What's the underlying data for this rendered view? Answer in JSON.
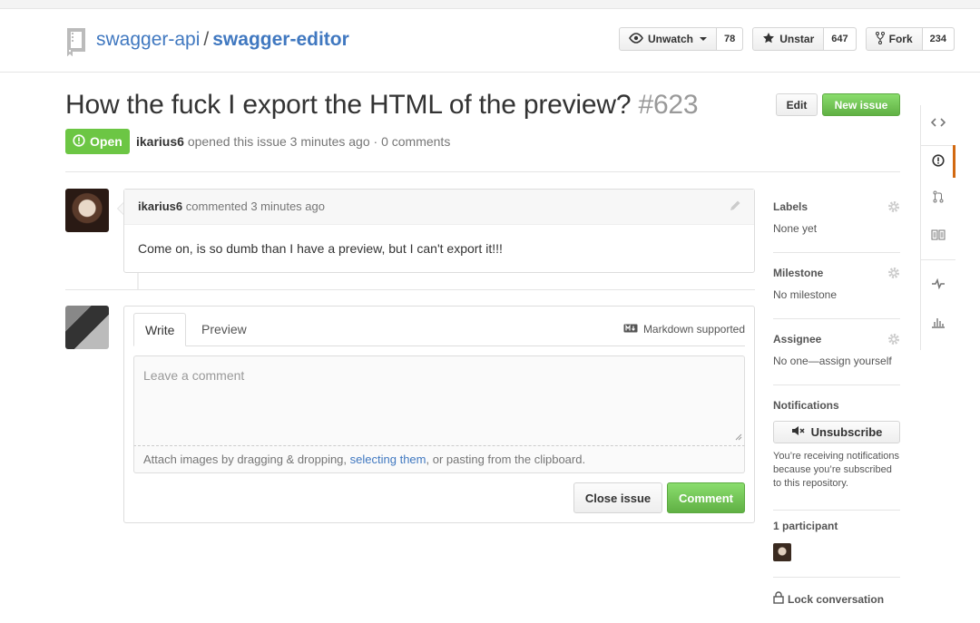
{
  "repo": {
    "owner": "swagger-api",
    "separator": "/",
    "name": "swagger-editor"
  },
  "actions": {
    "watch": {
      "label": "Unwatch",
      "count": "78"
    },
    "star": {
      "label": "Unstar",
      "count": "647"
    },
    "fork": {
      "label": "Fork",
      "count": "234"
    }
  },
  "issue": {
    "title": "How the fuck I export the HTML of the preview?",
    "number": "#623",
    "state": "Open",
    "author": "ikarius6",
    "meta_text": "opened this issue 3 minutes ago · 0 comments",
    "edit_label": "Edit",
    "new_issue_label": "New issue"
  },
  "comment": {
    "author": "ikarius6",
    "time": "commented 3 minutes ago",
    "body": "Come on, is so dumb than I have a preview, but I can't export it!!!"
  },
  "composer": {
    "tab_write": "Write",
    "tab_preview": "Preview",
    "markdown_note": "Markdown supported",
    "placeholder": "Leave a comment",
    "attach_prefix": "Attach images by dragging & dropping,",
    "attach_link": "selecting them",
    "attach_suffix": ", or pasting from the clipboard.",
    "close_label": "Close issue",
    "comment_label": "Comment"
  },
  "sidebar": {
    "labels_title": "Labels",
    "labels_value": "None yet",
    "milestone_title": "Milestone",
    "milestone_value": "No milestone",
    "assignee_title": "Assignee",
    "assignee_value": "No one—assign yourself",
    "notifications_title": "Notifications",
    "unsubscribe_label": "Unsubscribe",
    "notifications_note": "You’re receiving notifications because you’re subscribed to this repository.",
    "participants_title": "1 participant",
    "lock_label": "Lock conversation"
  },
  "colors": {
    "accent": "#4078c0",
    "open_green": "#6cc644",
    "active_tab": "#d26911"
  },
  "icons": [
    "repo-icon",
    "eye-icon",
    "star-icon",
    "fork-icon",
    "code-icon",
    "issue-icon",
    "pull-request-icon",
    "wiki-icon",
    "pulse-icon",
    "graph-icon",
    "pencil-icon",
    "markdown-icon",
    "gear-icon",
    "mute-icon",
    "lock-icon"
  ]
}
